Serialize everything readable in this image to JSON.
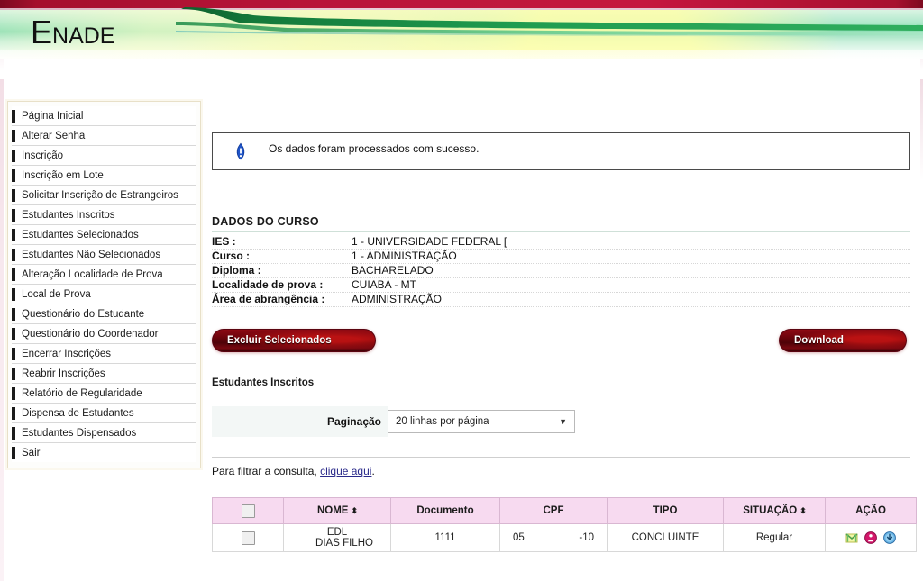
{
  "app": {
    "logo_first": "E",
    "logo_rest": "NADE"
  },
  "sidebar": {
    "items": [
      {
        "label": "Página Inicial"
      },
      {
        "label": "Alterar Senha"
      },
      {
        "label": "Inscrição"
      },
      {
        "label": "Inscrição em Lote"
      },
      {
        "label": "Solicitar Inscrição de Estrangeiros"
      },
      {
        "label": "Estudantes Inscritos"
      },
      {
        "label": "Estudantes Selecionados"
      },
      {
        "label": "Estudantes Não Selecionados"
      },
      {
        "label": "Alteração Localidade de Prova"
      },
      {
        "label": "Local de Prova"
      },
      {
        "label": "Questionário do Estudante"
      },
      {
        "label": "Questionário do Coordenador"
      },
      {
        "label": "Encerrar Inscrições"
      },
      {
        "label": "Reabrir Inscrições"
      },
      {
        "label": "Relatório de Regularidade"
      },
      {
        "label": "Dispensa de Estudantes"
      },
      {
        "label": "Estudantes Dispensados"
      },
      {
        "label": "Sair"
      }
    ]
  },
  "message": {
    "icon": "info-icon",
    "text": "Os dados foram processados com sucesso."
  },
  "course": {
    "title": "DADOS DO CURSO",
    "rows": [
      {
        "label": "IES :",
        "value": "1 - UNIVERSIDADE FEDERAL ["
      },
      {
        "label": "Curso :",
        "value": "1  - ADMINISTRAÇÃO"
      },
      {
        "label": "Diploma :",
        "value": "BACHARELADO"
      },
      {
        "label": "Localidade de prova :",
        "value": "CUIABA - MT"
      },
      {
        "label": "Área de abrangência :",
        "value": "ADMINISTRAÇÃO"
      }
    ]
  },
  "actions": {
    "excluir_label": "Excluir Selecionados",
    "download_label": "Download"
  },
  "list": {
    "heading": "Estudantes Inscritos",
    "pagination_label": "Paginação",
    "pagination_value": "20 linhas por página",
    "pagination_caret": "▼",
    "filter_prefix": "Para filtrar a consulta, ",
    "filter_link": "clique aqui",
    "filter_suffix": "."
  },
  "table": {
    "columns": [
      {
        "label": "",
        "sortable": false
      },
      {
        "label": "NOME",
        "sortable": true
      },
      {
        "label": "Documento",
        "sortable": false
      },
      {
        "label": "CPF",
        "sortable": false
      },
      {
        "label": "TIPO",
        "sortable": false
      },
      {
        "label": "SITUAÇÃO",
        "sortable": true
      },
      {
        "label": "AÇÃO",
        "sortable": false
      }
    ],
    "sort_glyph": "⬍",
    "rows": [
      {
        "nome_l1": "EDL",
        "nome_l2": "DIAS FILHO",
        "documento": "1111",
        "cpf_left": "05",
        "cpf_right": "-10",
        "tipo": "CONCLUINTE",
        "situacao": "Regular",
        "acoes": [
          "envelope-icon",
          "person-delete-icon",
          "download-info-icon"
        ]
      }
    ]
  },
  "colors": {
    "header_red": "#b9143a",
    "banner_green": "#9fe4c0",
    "table_header_pink": "#f7daf0",
    "link_blue": "#2a2a8a",
    "button_red": "#6e040c"
  }
}
